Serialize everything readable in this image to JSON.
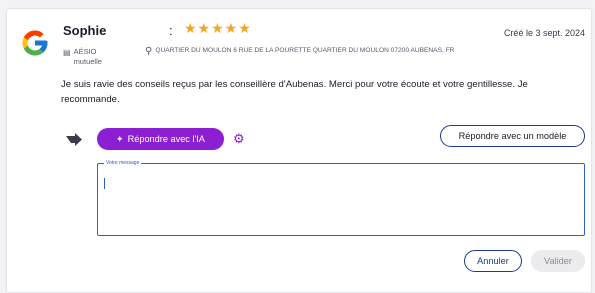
{
  "review": {
    "author": "Sophie",
    "separator": ":",
    "stars": "★★★★★",
    "rating": 5,
    "company": "AÉSIO mutuelle",
    "address": "QUARTIER DU MOULON 6 RUE DE LA POURETTE QUARTIER DU MOULON 07200 AUBENAS, FR",
    "date": "Créé le 3 sept. 2024",
    "text": "Je suis ravie des conseils reçus par les conseillère d'Aubenas. Merci pour votre écoute et votre gentillesse. Je recommande."
  },
  "actions": {
    "ai_reply_label": "Répondre avec l'IA",
    "model_reply_label": "Répondre avec un modèle",
    "message_label": "Votre message",
    "message_value": "",
    "cancel_label": "Annuler",
    "validate_label": "Valider"
  },
  "icons": {
    "source": "google-logo-icon",
    "company": "building-icon",
    "address": "location-pin-icon",
    "reply": "reply-arrow-icon",
    "ai": "sparkles-icon",
    "settings": "gear-icon"
  },
  "colors": {
    "accent_purple": "#8b1fd1",
    "outline_blue": "#1e3a8a",
    "field_blue": "#2d5fd0",
    "star_orange": "#f5a524"
  }
}
